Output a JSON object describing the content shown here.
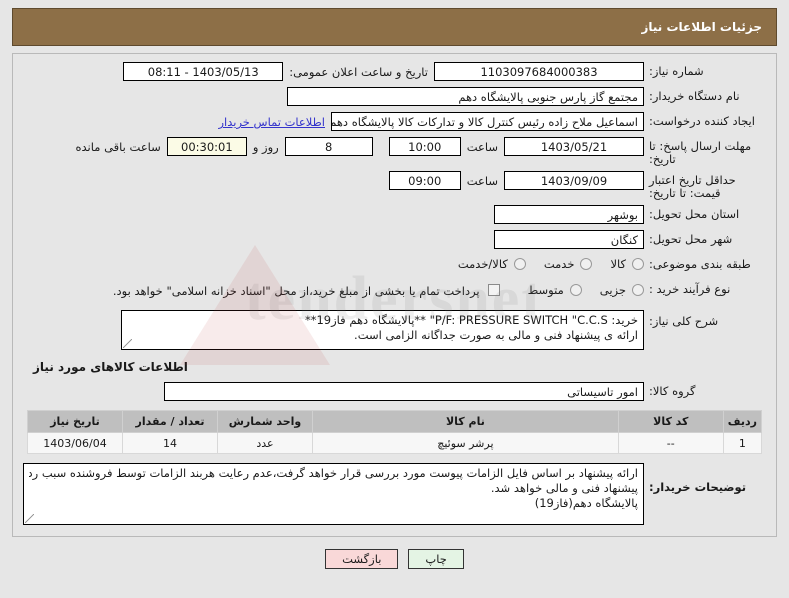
{
  "header": {
    "title": "جزئیات اطلاعات نیاز"
  },
  "form": {
    "need_number_label": "شماره نیاز:",
    "need_number_value": "1103097684000383",
    "announce_datetime_label": "تاریخ و ساعت اعلان عمومی:",
    "announce_datetime_value": "1403/05/13 - 08:11",
    "buyer_org_label": "نام دستگاه خریدار:",
    "buyer_org_value": "مجتمع گاز پارس جنوبی  پالایشگاه دهم",
    "requester_label": "ایجاد کننده درخواست:",
    "requester_value": "اسماعیل ملاح زاده رئیس کنترل کالا و تدارکات کالا پالایشگاه دهم مجتمع گاز پارس ج",
    "contact_link": "اطلاعات تماس خریدار",
    "response_deadline_label": "مهلت ارسال پاسخ: تا تاریخ:",
    "response_deadline_date": "1403/05/21",
    "response_deadline_hour_label": "ساعت",
    "response_deadline_time": "10:00",
    "remaining_days": "8",
    "remaining_days_label": "روز و",
    "remaining_clock": "00:30:01",
    "remaining_clock_label": "ساعت باقی مانده",
    "price_validity_label": "حداقل تاریخ اعتبار قیمت: تا تاریخ:",
    "price_validity_date": "1403/09/09",
    "price_validity_hour_label": "ساعت",
    "price_validity_time": "09:00",
    "province_label": "استان محل تحویل:",
    "province_value": "بوشهر",
    "city_label": "شهر محل تحویل:",
    "city_value": "کنگان",
    "category_label": "طبقه بندی موضوعی:",
    "category_options": [
      "کالا",
      "خدمت",
      "کالا/خدمت"
    ],
    "process_label": "نوع فرآیند خرید :",
    "process_options": [
      "جزیی",
      "متوسط"
    ],
    "treasury_note": "پرداخت تمام یا بخشی از مبلغ خرید،از محل \"اسناد خزانه اسلامی\" خواهد بود."
  },
  "description": {
    "label": "شرح کلی نیاز:",
    "line1": "خرید:  P/F: PRESSURE SWITCH \"C.C.S\" **پالایشگاه دهم فاز19**",
    "line2": "ارائه ی پیشنهاد فنی و مالی به صورت جداگانه الزامی است."
  },
  "goods_section": {
    "title": "اطلاعات کالاهای مورد نیاز",
    "group_label": "گروه کالا:",
    "group_value": "امور تاسیساتی"
  },
  "table": {
    "columns": [
      "ردیف",
      "کد کالا",
      "نام کالا",
      "واحد شمارش",
      "تعداد / مقدار",
      "تاریخ نیاز"
    ],
    "rows": [
      {
        "index": "1",
        "code": "--",
        "name": "پرشر سوئیچ",
        "unit": "عدد",
        "quantity": "14",
        "need_date": "1403/06/04"
      }
    ]
  },
  "buyer_notes": {
    "label": "توضیحات خریدار:",
    "line1": "ارائه پیشنهاد بر اساس فایل الزامات پیوست مورد بررسی قرار خواهد گرفت،عدم رعایت هربند الزامات توسط فروشنده سبب رد",
    "line2": "پیشنهاد فنی و مالی خواهد شد.",
    "line3": "پالایشگاه دهم(فاز19)"
  },
  "footer": {
    "print_button": "چاپ",
    "back_button": "بازگشت"
  },
  "watermark": {
    "text": "tendersnet"
  }
}
